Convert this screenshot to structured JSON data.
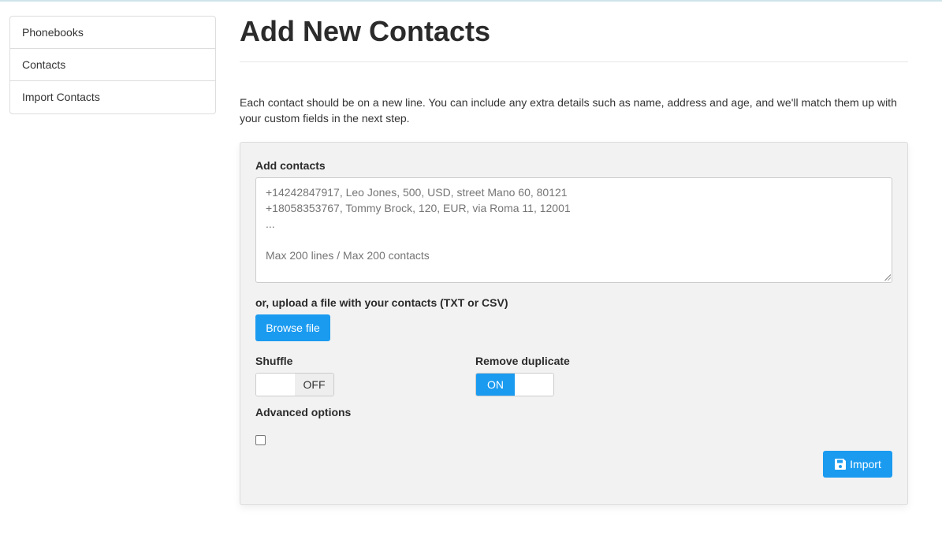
{
  "sidebar": {
    "items": [
      {
        "label": "Phonebooks"
      },
      {
        "label": "Contacts"
      },
      {
        "label": "Import Contacts"
      }
    ]
  },
  "main": {
    "title": "Add New Contacts",
    "intro": "Each contact should be on a new line. You can include any extra details such as name, address and age, and we'll match them up with your custom fields in the next step."
  },
  "form": {
    "add_contacts_label": "Add contacts",
    "textarea_placeholder": "+14242847917, Leo Jones, 500, USD, street Mano 60, 80121\n+18058353767, Tommy Brock, 120, EUR, via Roma 11, 12001\n...\n\nMax 200 lines / Max 200 contacts",
    "upload_label": "or, upload a file with your contacts (TXT or CSV)",
    "browse_label": "Browse file",
    "shuffle_label": "Shuffle",
    "shuffle_state": "OFF",
    "remove_duplicate_label": "Remove duplicate",
    "remove_duplicate_state": "ON",
    "advanced_label": "Advanced options",
    "advanced_checked": false,
    "import_label": "Import",
    "import_icon": "floppy-disk-icon"
  },
  "colors": {
    "accent": "#1a9bf0",
    "panel_bg": "#f2f2f2"
  }
}
